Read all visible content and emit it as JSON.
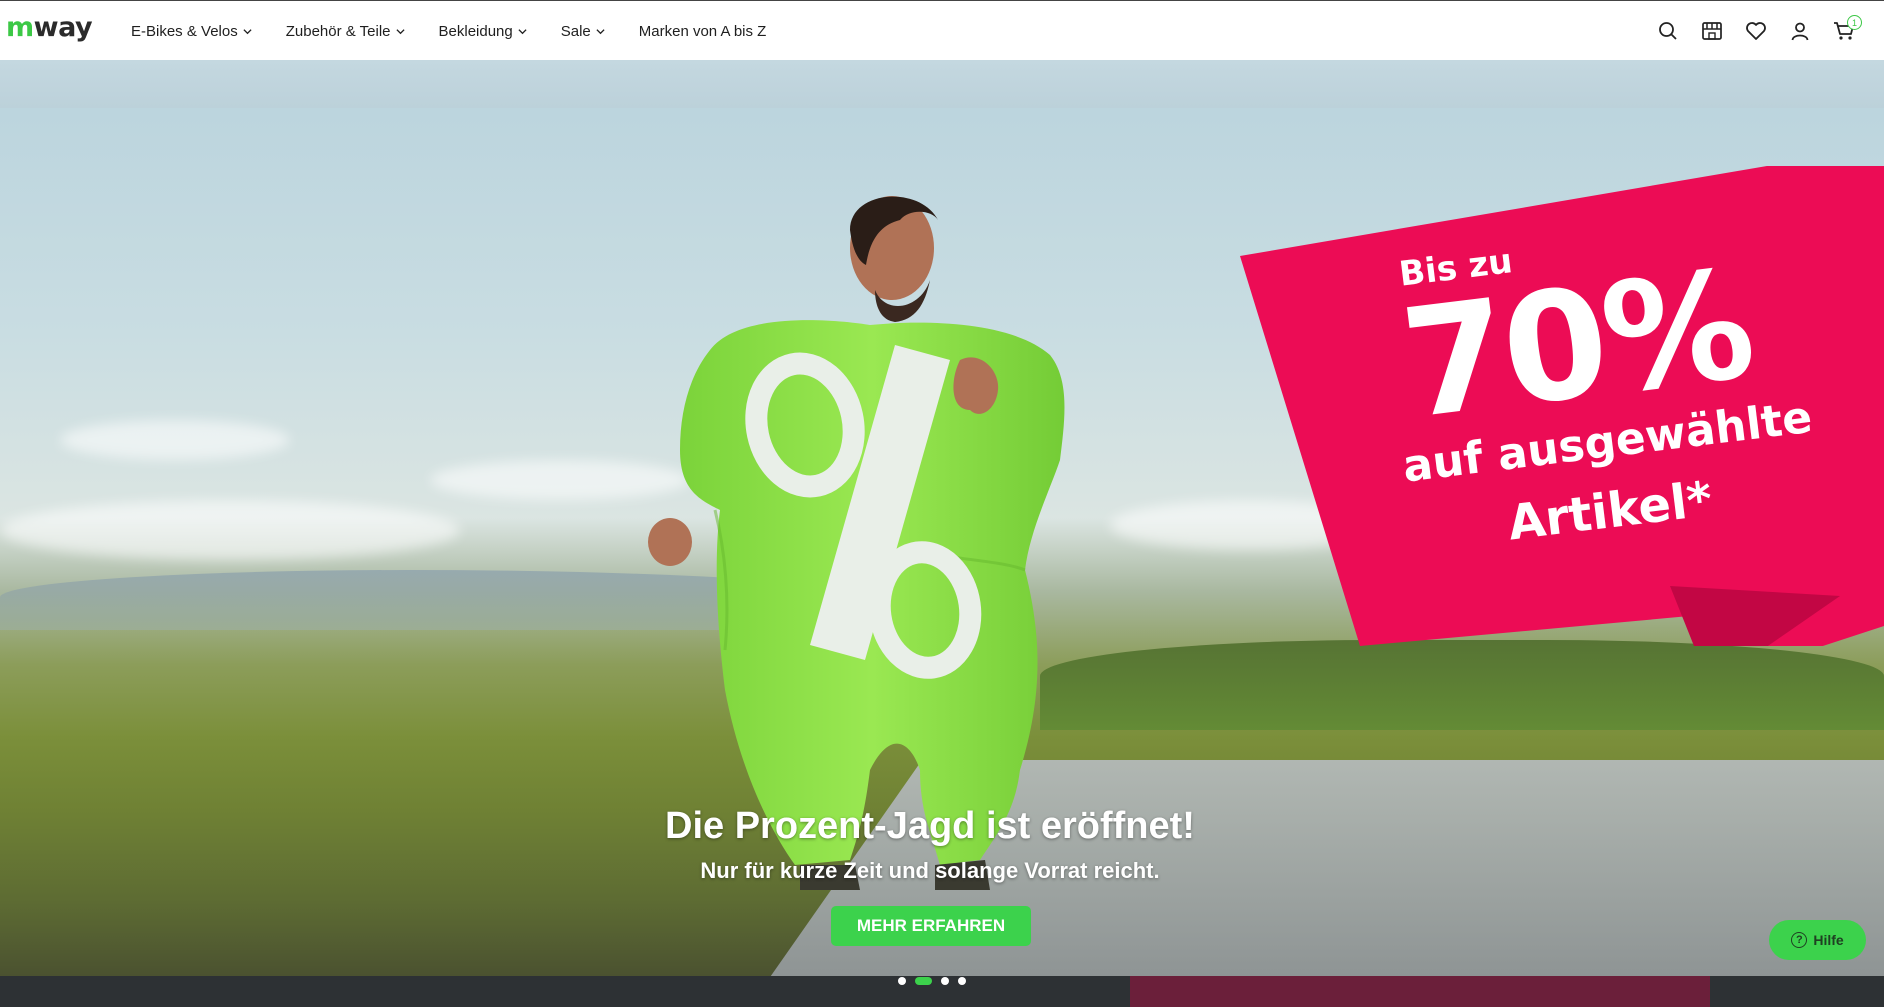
{
  "header": {
    "logo_m": "m",
    "logo_way": "way",
    "nav": [
      {
        "label": "E-Bikes & Velos",
        "has_dropdown": true
      },
      {
        "label": "Zubehör & Teile",
        "has_dropdown": true
      },
      {
        "label": "Bekleidung",
        "has_dropdown": true
      },
      {
        "label": "Sale",
        "has_dropdown": true
      },
      {
        "label": "Marken von A bis Z",
        "has_dropdown": false
      }
    ],
    "icons": [
      "search-icon",
      "store-icon",
      "heart-icon",
      "user-icon",
      "cart-icon"
    ],
    "cart_count": "1"
  },
  "hero": {
    "banner_line1": "Bis zu",
    "banner_line2": "70%",
    "banner_line3": "auf ausgewählte",
    "banner_line4": "Artikel*",
    "title": "Die Prozent-Jagd ist eröffnet!",
    "subtitle": "Nur für kurze Zeit und solange Vorrat reicht.",
    "cta_label": "MEHR ERFAHREN",
    "slide_count": 4,
    "active_slide": 2
  },
  "help": {
    "label": "Hilfe"
  },
  "colors": {
    "brand_green": "#3cd24c",
    "banner_pink": "#ec0c55",
    "suit_green": "#8ee04c"
  }
}
